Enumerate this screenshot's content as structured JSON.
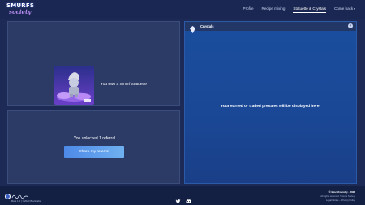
{
  "brand": {
    "logo_line1": "SMURFS",
    "logo_line2": "society"
  },
  "nav": {
    "items": [
      {
        "label": "Profile",
        "active": false
      },
      {
        "label": "Recipe mixing",
        "active": false
      },
      {
        "label": "Statuette & Crystals",
        "active": true
      },
      {
        "label": "Come back",
        "active": false,
        "has_dropdown": true
      }
    ]
  },
  "statuette": {
    "text": "You own a Smurf Statuette"
  },
  "referral": {
    "text": "You unlocked 1 referral",
    "button": "Share my referral"
  },
  "crystals": {
    "title": "Crystals",
    "info_icon": "?",
    "empty_message": "Your earned or traded presales will be displayed here."
  },
  "footer": {
    "version": "Beta 1.0 | ©2023 Blocklabs",
    "copyright": "© BlockFoundry - 2023",
    "rights": "All rights reserved. Smurfs Society",
    "links": "Legal Notice – Privacy Policy"
  },
  "colors": {
    "accent": "#4d8ae8",
    "background": "#1c2a55",
    "panel": "#2b3b66",
    "crystals_panel": "#1a4896"
  },
  "icons": [
    "crystal-icon",
    "info-icon",
    "twitter-icon",
    "discord-icon",
    "chevron-down-icon"
  ]
}
